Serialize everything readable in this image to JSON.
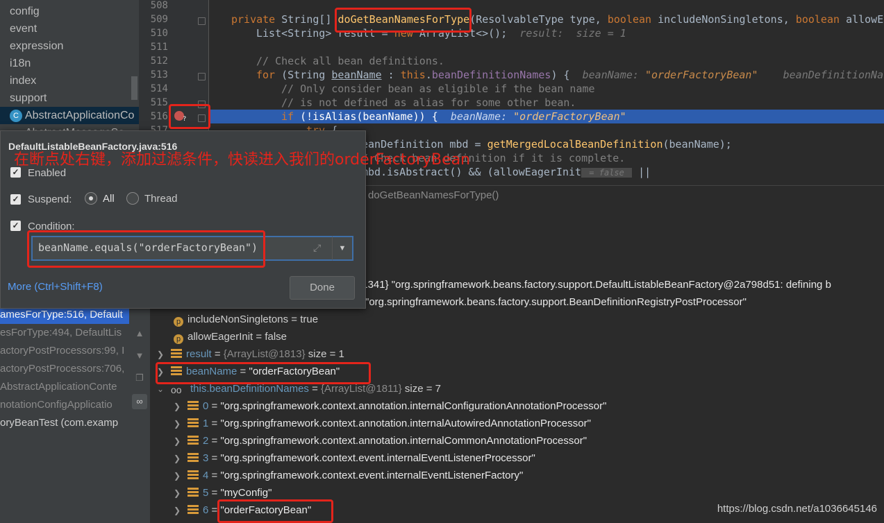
{
  "project_tree": [
    "config",
    "event",
    "expression",
    "i18n",
    "index",
    "support",
    "AbstractApplicationCo",
    "AbstractMessageSo"
  ],
  "editor": {
    "line_numbers": [
      "508",
      "509",
      "510",
      "511",
      "512",
      "513",
      "514",
      "515",
      "516",
      "517"
    ],
    "method_name": "doGetBeanNamesForType",
    "signature_bar": "doGetBeanNamesForType()"
  },
  "popup": {
    "title": "DefaultListableBeanFactory.java:516",
    "enabled_label": "Enabled",
    "suspend_label": "Suspend:",
    "all_label": "All",
    "thread_label": "Thread",
    "condition_label": "Condition:",
    "condition_value": "beanName.equals(\"orderFactoryBean\")",
    "more_link": "More (Ctrl+Shift+F8)",
    "done_label": "Done"
  },
  "annotation_caption": "在断点处右键，添加过滤条件，快读进入我们的orderFactoryBean",
  "frames": [
    "amesForType:516, Default",
    "esForType:494, DefaultLis",
    "actoryPostProcessors:99, I",
    "actoryPostProcessors:706,",
    "AbstractApplicationConte",
    "notationConfigApplicatio",
    "oryBeanTest (com.examp"
  ],
  "variables": {
    "this_partial": "@1341} \"org.springframework.beans.factory.support.DefaultListableBeanFactory@2a798d51: defining b",
    "type_partial": "\"org.springframework.beans.factory.support.BeanDefinitionRegistryPostProcessor\"",
    "include_non_singletons": "includeNonSingletons = true",
    "allow_eager_init": "allowEagerInit = false",
    "result_name": "result",
    "result_meta": "{ArrayList@1813}",
    "result_size": "size = 1",
    "bean_name_name": "beanName",
    "bean_name_value": "\"orderFactoryBean\"",
    "defs_name": "this.beanDefinitionNames",
    "defs_meta": "{ArrayList@1811}",
    "defs_size": "size = 7",
    "entries": [
      {
        "idx": "0",
        "value": "\"org.springframework.context.annotation.internalConfigurationAnnotationProcessor\""
      },
      {
        "idx": "1",
        "value": "\"org.springframework.context.annotation.internalAutowiredAnnotationProcessor\""
      },
      {
        "idx": "2",
        "value": "\"org.springframework.context.annotation.internalCommonAnnotationProcessor\""
      },
      {
        "idx": "3",
        "value": "\"org.springframework.context.event.internalEventListenerProcessor\""
      },
      {
        "idx": "4",
        "value": "\"org.springframework.context.event.internalEventListenerFactory\""
      },
      {
        "idx": "5",
        "value": "\"myConfig\""
      },
      {
        "idx": "6",
        "value": "\"orderFactoryBean\""
      }
    ]
  },
  "watermark": "https://blog.csdn.net/a1036645146",
  "colors": {
    "background": "#2b2b2b",
    "panel": "#3c3f41",
    "highlight": "#2d5dae",
    "annotation_red": "#e3241b"
  }
}
